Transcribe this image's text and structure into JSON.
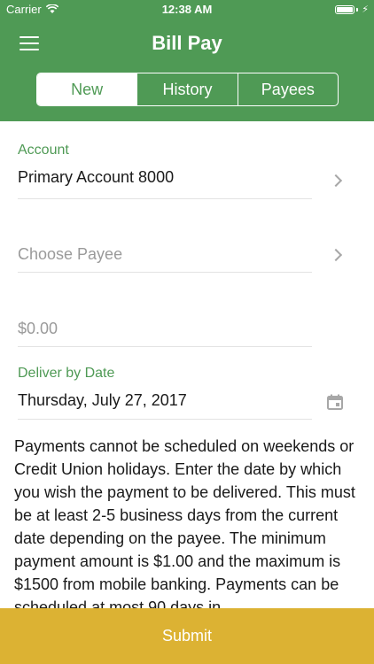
{
  "status_bar": {
    "carrier": "Carrier",
    "time": "12:38 AM"
  },
  "header": {
    "title": "Bill Pay",
    "tabs": [
      {
        "label": "New",
        "active": true
      },
      {
        "label": "History",
        "active": false
      },
      {
        "label": "Payees",
        "active": false
      }
    ]
  },
  "form": {
    "account_label": "Account",
    "account_value": "Primary Account 8000",
    "payee_placeholder": "Choose Payee",
    "amount_placeholder": "$0.00",
    "date_label": "Deliver by Date",
    "date_value": "Thursday, July 27, 2017"
  },
  "info_text": "Payments cannot be scheduled on weekends or Credit Union holidays. Enter the date by which you wish the payment to be delivered. This must be at least 2-5 business days from the current date depending on the payee. The minimum payment amount is $1.00 and the maximum is $1500 from mobile banking. Payments can be scheduled at most 90 days in",
  "submit_label": "Submit",
  "colors": {
    "brand_green": "#4f9a55",
    "submit_yellow": "#dcb233"
  }
}
